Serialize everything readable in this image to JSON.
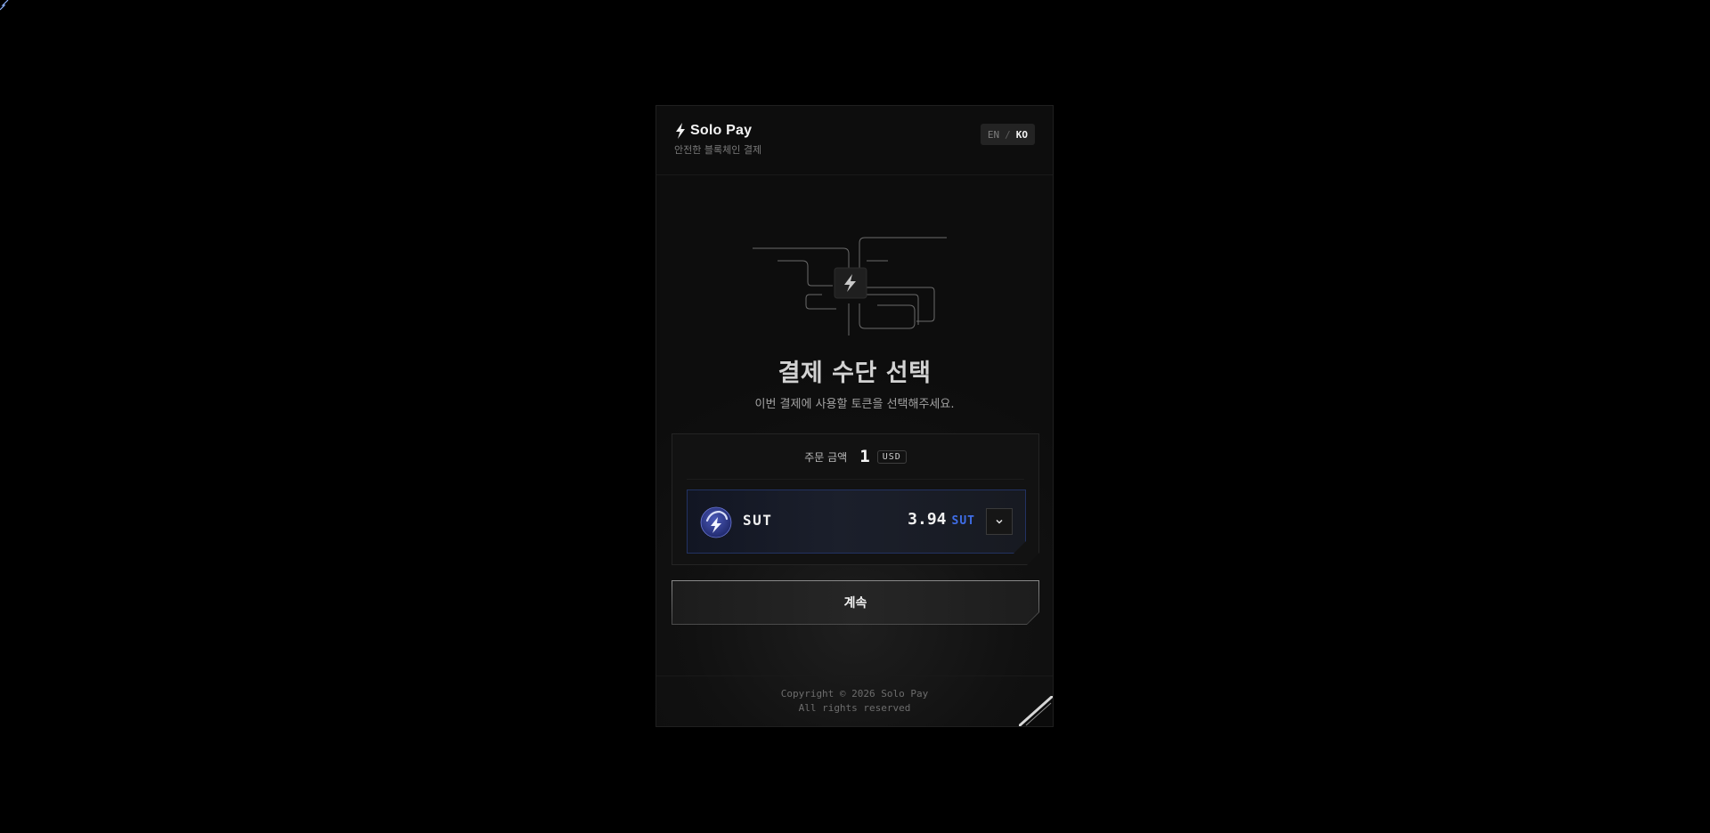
{
  "brand": {
    "name": "Solo Pay",
    "tagline": "안전한 블록체인 결제"
  },
  "language": {
    "options": [
      "EN",
      "KO"
    ],
    "separator": "/",
    "selected": "KO"
  },
  "main": {
    "title": "결제 수단 선택",
    "subtitle": "이번 결제에 사용할 토큰을 선택해주세요."
  },
  "order": {
    "label": "주문 금액",
    "amount": "1",
    "currency": "USD"
  },
  "token": {
    "symbol": "SUT",
    "amount": "3.94",
    "unit": "SUT",
    "icon": "lightning-icon"
  },
  "actions": {
    "continue_label": "계속"
  },
  "footer": {
    "copyright": "Copyright © 2026 Solo Pay",
    "rights": "All rights reserved"
  },
  "colors": {
    "background": "#000000",
    "card": "#111111",
    "accent_blue": "#3f6ee8",
    "token_border": "#223262"
  }
}
